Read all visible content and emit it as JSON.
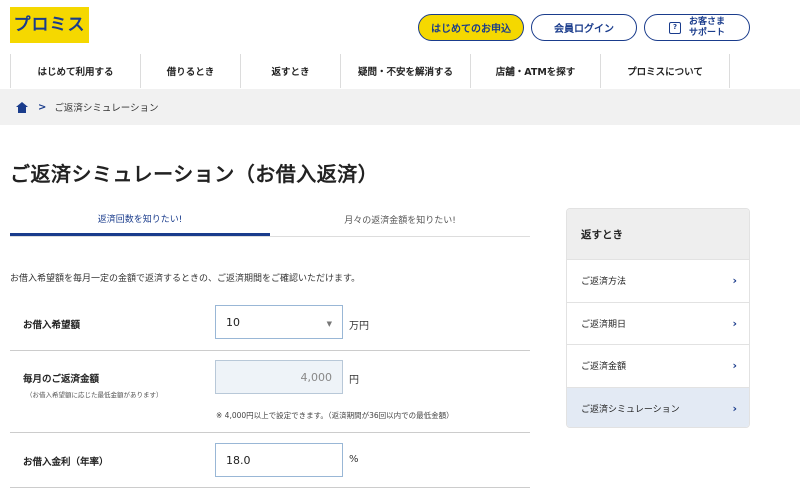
{
  "header": {
    "logo": "プロミス",
    "apply_label": "はじめてのお申込",
    "login_label": "会員ログイン",
    "support_line1": "お客さま",
    "support_line2": "サポート",
    "brand_yellow": "#f5d800",
    "brand_navy": "#1a3c8c"
  },
  "nav": {
    "items": [
      "はじめて利用する",
      "借りるとき",
      "返すとき",
      "疑問・不安を解消する",
      "店舗・ATMを探す",
      "プロミスについて"
    ]
  },
  "breadcrumb": {
    "current": "ご返済シミュレーション"
  },
  "page_title": "ご返済シミュレーション（お借入返済）",
  "tabs": [
    {
      "label": "返済回数を知りたい!",
      "active": true
    },
    {
      "label": "月々の返済金額を知りたい!",
      "active": false
    }
  ],
  "intro": "お借入希望額を毎月一定の金額で返済するときの、ご返済期間をご確認いただけます。",
  "form": {
    "amount": {
      "label": "お借入希望額",
      "value": "10",
      "unit": "万円"
    },
    "monthly": {
      "label": "毎月のご返済金額",
      "sub": "（お借入希望額に応じた最低金額があります）",
      "value": "4,000",
      "unit": "円",
      "note": "※ 4,000円以上で設定できます。（返済期間が36回以内での最低金額）"
    },
    "rate": {
      "label": "お借入金利（年率）",
      "value": "18.0",
      "unit": "%"
    }
  },
  "sidebar": {
    "title": "返すとき",
    "items": [
      {
        "label": "ご返済方法"
      },
      {
        "label": "ご返済期日"
      },
      {
        "label": "ご返済金額"
      },
      {
        "label": "ご返済シミュレーション"
      }
    ]
  }
}
